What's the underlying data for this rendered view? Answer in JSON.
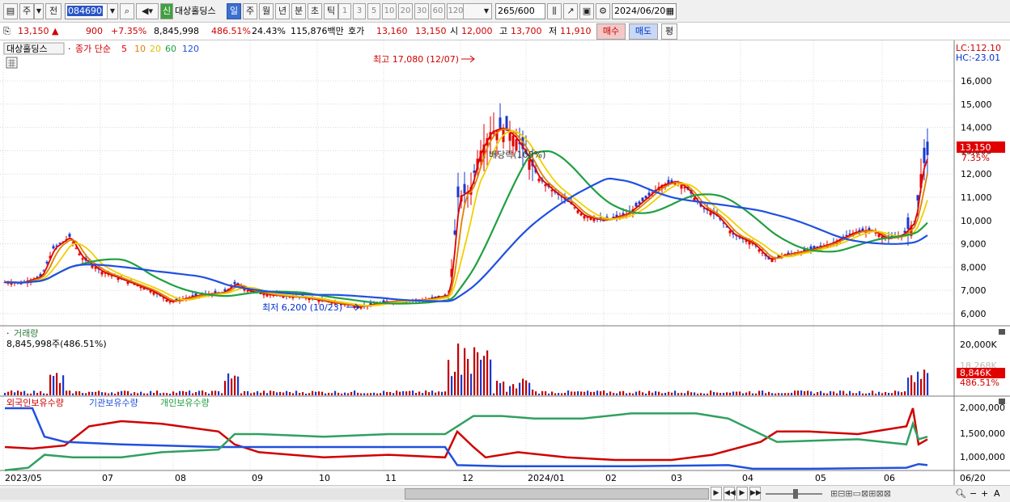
{
  "toolbar": {
    "market_label": "주",
    "prev_label": "전",
    "code_value": "084690",
    "name_badge": "신",
    "stock_name": "대상홀딩스",
    "period_tabs": [
      "일",
      "주",
      "월",
      "년",
      "분",
      "초",
      "틱"
    ],
    "selected_period": "일",
    "number_tabs": [
      "1",
      "3",
      "5",
      "10",
      "20",
      "30",
      "60",
      "120"
    ],
    "count_value": "265",
    "count_total": "/600",
    "date_value": "2024/06/20"
  },
  "quote": {
    "price": "13,150",
    "arrow": "▲",
    "change": "900",
    "change_pct": "+7.35%",
    "volume": "8,845,998",
    "volume_ratio": "486.51%",
    "turnover": "24.43%",
    "amount": "115,876백만",
    "ask_label": "호가",
    "ask": "13,160",
    "bid": "13,150",
    "open_label": "시",
    "open": "12,000",
    "high_label": "고",
    "high": "13,700",
    "low_label": "저",
    "low": "11,910",
    "buy_button": "매수",
    "sell_button": "매도",
    "eval_button": "평"
  },
  "price_panel": {
    "stock_tag": "대상홀딩스",
    "legend_prefix": "종가 단순",
    "ma_labels": [
      "5",
      "10",
      "20",
      "60",
      "120"
    ],
    "ma_colors": [
      "#e00000",
      "#e08000",
      "#f0d000",
      "#20a040",
      "#2050e0"
    ],
    "lc_label": "LC:112.10",
    "hc_label": "HC:-23.01",
    "high_annotation": "최고 17,080 (12/07)",
    "low_annotation": "최저 6,200 (10/23)",
    "dividend_annotation": "배당락(100%)",
    "price_tag": "13,150",
    "price_tag_pct": "7.35%",
    "y_ticks": [
      "16,000",
      "15,000",
      "14,000",
      "13,000",
      "12,000",
      "11,000",
      "10,000",
      "9,000",
      "8,000",
      "7,000",
      "6,000"
    ]
  },
  "volume_panel": {
    "title": "거래량",
    "current": "8,845,998주(486.51%)",
    "y_tick": "20,000K",
    "y_tick_faded": "18,268K",
    "tag": "8,846K",
    "tag_pct": "486.51%"
  },
  "holding_panel": {
    "legend": [
      "외국인보유수량",
      "기관보유수량",
      "개인보유수량"
    ],
    "legend_colors": [
      "#d00000",
      "#2050e0",
      "#20a040"
    ],
    "y_ticks": [
      "2,000,000",
      "1,500,000",
      "1,000,000"
    ]
  },
  "x_labels": [
    "2023/05",
    "07",
    "08",
    "09",
    "10",
    "11",
    "12",
    "2024/01",
    "02",
    "03",
    "04",
    "05",
    "06"
  ],
  "x_right_label": "06/20",
  "chart_data": {
    "type": "line",
    "price_axis_range": [
      5600,
      16800
    ],
    "candles_approx": [
      {
        "label": "2023/05",
        "close": 7350
      },
      {
        "label": "2023/06",
        "close": 9300
      },
      {
        "label": "2023/06 late",
        "close": 7700
      },
      {
        "label": "07",
        "close": 7600
      },
      {
        "label": "08",
        "close": 6700
      },
      {
        "label": "09",
        "close": 7000
      },
      {
        "label": "10",
        "close": 6300
      },
      {
        "label": "11",
        "close": 6700
      },
      {
        "label": "12",
        "close": 14000
      },
      {
        "label": "2024/01",
        "close": 11000
      },
      {
        "label": "02",
        "close": 10000
      },
      {
        "label": "03",
        "close": 11600
      },
      {
        "label": "04",
        "close": 8400
      },
      {
        "label": "05",
        "close": 9400
      },
      {
        "label": "06",
        "close": 13150
      }
    ]
  }
}
